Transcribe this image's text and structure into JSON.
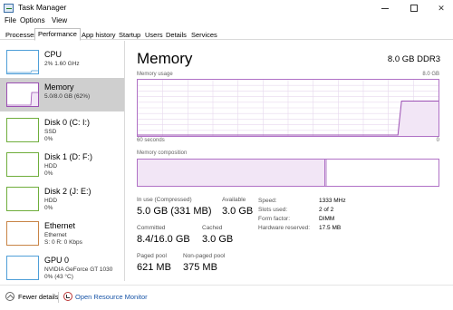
{
  "window": {
    "title": "Task Manager",
    "minimize_icon": "minimize-icon",
    "maximize_icon": "maximize-icon",
    "close_glyph": "✕"
  },
  "menu": [
    {
      "label": "File"
    },
    {
      "label": "Options"
    },
    {
      "label": "View"
    }
  ],
  "tabs": [
    {
      "label": "Processes"
    },
    {
      "label": "Performance",
      "active": true
    },
    {
      "label": "App history"
    },
    {
      "label": "Startup"
    },
    {
      "label": "Users"
    },
    {
      "label": "Details"
    },
    {
      "label": "Services"
    }
  ],
  "sidebar": {
    "items": [
      {
        "title": "CPU",
        "sub1": "2% 1.60 GHz",
        "sub2": ""
      },
      {
        "title": "Memory",
        "sub1": "5.0/8.0 GB (62%)",
        "sub2": "",
        "selected": true
      },
      {
        "title": "Disk 0 (C: I:)",
        "sub1": "SSD",
        "sub2": "0%"
      },
      {
        "title": "Disk 1 (D: F:)",
        "sub1": "HDD",
        "sub2": "0%"
      },
      {
        "title": "Disk 2 (J: E:)",
        "sub1": "HDD",
        "sub2": "0%"
      },
      {
        "title": "Ethernet",
        "sub1": "Ethernet",
        "sub2": "S: 0 R: 0 Kbps"
      },
      {
        "title": "GPU 0",
        "sub1": "NVIDIA GeForce GT 1030",
        "sub2": "0% (43 °C)"
      }
    ]
  },
  "main": {
    "title": "Memory",
    "spec": "8.0 GB DDR3",
    "usage_label": "Memory usage",
    "usage_max": "8.0 GB",
    "time_left": "60 seconds",
    "time_right": "0",
    "composition_label": "Memory composition",
    "in_use_fraction": 0.62
  },
  "stats": {
    "in_use_label": "In use (Compressed)",
    "in_use_value": "5.0 GB (331 MB)",
    "available_label": "Available",
    "available_value": "3.0 GB",
    "committed_label": "Committed",
    "committed_value": "8.4/16.0 GB",
    "cached_label": "Cached",
    "cached_value": "3.0 GB",
    "paged_label": "Paged pool",
    "paged_value": "621 MB",
    "nonpaged_label": "Non-paged pool",
    "nonpaged_value": "375 MB"
  },
  "details": {
    "speed_label": "Speed:",
    "speed_value": "1333 MHz",
    "slots_label": "Slots used:",
    "slots_value": "2 of 2",
    "form_label": "Form factor:",
    "form_value": "DIMM",
    "hw_label": "Hardware reserved:",
    "hw_value": "17.5 MB"
  },
  "footer": {
    "fewer_details": "Fewer details",
    "open_resource_monitor": "Open Resource Monitor"
  },
  "colors": {
    "memory_accent": "#b071c6",
    "cpu_accent": "#4f9fd8",
    "disk_accent": "#6fae3c",
    "ethernet_accent": "#c88446",
    "link": "#1a56a8"
  }
}
